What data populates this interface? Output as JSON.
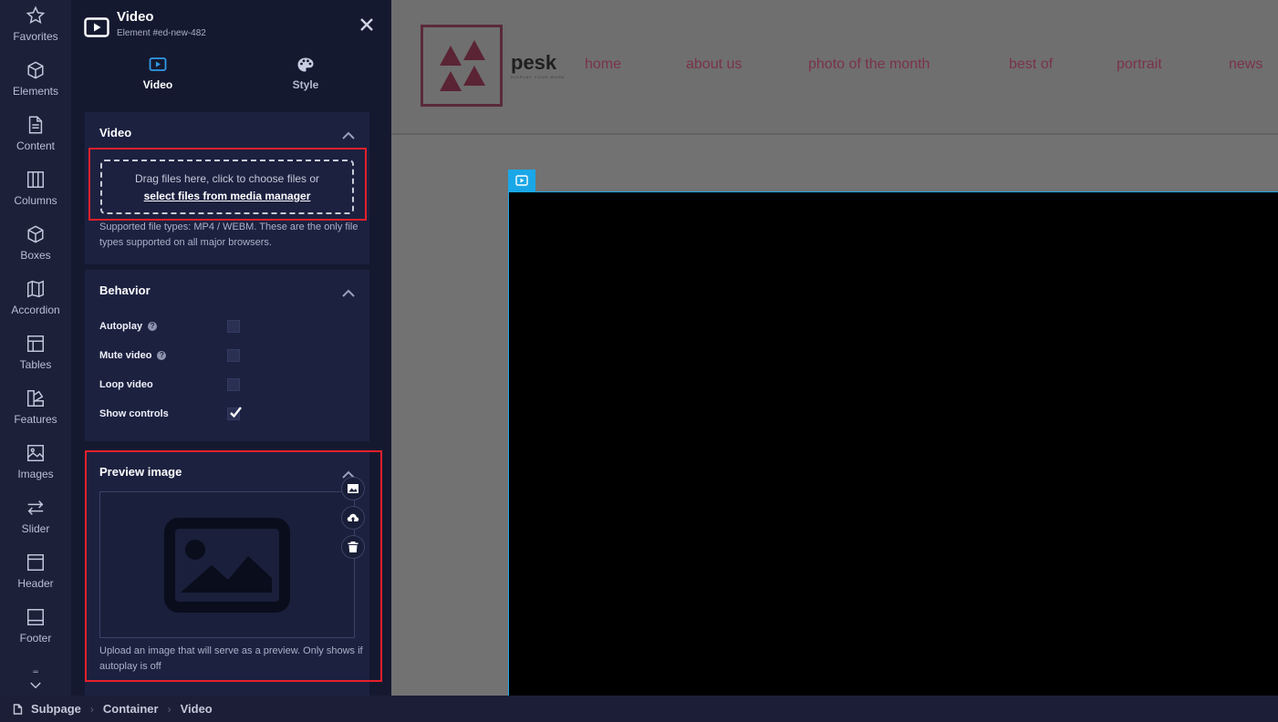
{
  "rail": {
    "items": [
      {
        "label": "Favorites",
        "icon": "star-icon"
      },
      {
        "label": "Elements",
        "icon": "cube-icon"
      },
      {
        "label": "Content",
        "icon": "document-icon"
      },
      {
        "label": "Columns",
        "icon": "columns-icon"
      },
      {
        "label": "Boxes",
        "icon": "box-icon"
      },
      {
        "label": "Accordion",
        "icon": "accordion-icon"
      },
      {
        "label": "Tables",
        "icon": "table-icon"
      },
      {
        "label": "Features",
        "icon": "features-icon"
      },
      {
        "label": "Images",
        "icon": "image-icon"
      },
      {
        "label": "Slider",
        "icon": "slider-arrows-icon"
      },
      {
        "label": "Header",
        "icon": "header-icon"
      },
      {
        "label": "Footer",
        "icon": "footer-icon"
      }
    ]
  },
  "panel": {
    "title": "Video",
    "subtitle": "Element #ed-new-482",
    "tabs": [
      {
        "label": "Video",
        "active": true
      },
      {
        "label": "Style",
        "active": false
      }
    ],
    "video_section": {
      "heading": "Video",
      "drop_text": "Drag files here, click to choose files or",
      "drop_link": "select files from media manager",
      "help": "Supported file types: MP4 / WEBM. These are the only file types supported on all major browsers."
    },
    "behavior_section": {
      "heading": "Behavior",
      "options": [
        {
          "label": "Autoplay",
          "has_help": true,
          "checked": false
        },
        {
          "label": "Mute video",
          "has_help": true,
          "checked": false
        },
        {
          "label": "Loop video",
          "has_help": false,
          "checked": false
        },
        {
          "label": "Show controls",
          "has_help": false,
          "checked": true
        }
      ],
      "help_glyph": "?"
    },
    "preview_section": {
      "heading": "Preview image",
      "help": "Upload an image that will serve as a preview. Only shows if autoplay is off"
    }
  },
  "site": {
    "brand": "pesk",
    "brand_sub": "DISPLAY YOUR WORK",
    "nav": [
      "home",
      "about us",
      "photo of the month",
      "best of",
      "portrait",
      "news"
    ]
  },
  "breadcrumb": [
    "Subpage",
    "Container",
    "Video"
  ],
  "breadcrumb_sep": "›",
  "colors": {
    "highlight_red": "#e5202a",
    "selection_blue": "#1aa7e8",
    "nav_text": "#7a3348",
    "panel_bg": "#151930"
  }
}
